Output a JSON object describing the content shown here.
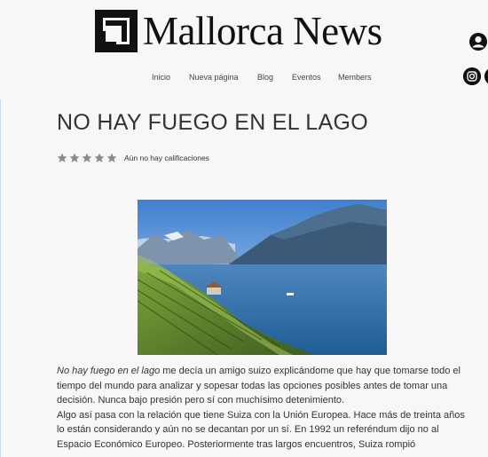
{
  "site": {
    "name": "Mallorca News"
  },
  "nav": {
    "items": [
      {
        "label": "Inicio"
      },
      {
        "label": "Nueva página"
      },
      {
        "label": "Blog"
      },
      {
        "label": "Eventos"
      },
      {
        "label": "Members"
      }
    ]
  },
  "post": {
    "title": "NO HAY FUEGO EN EL LAGO",
    "rating_text": "Aún no hay calificaciones",
    "rating_value": 0,
    "rating_max": 5,
    "paragraphs": [
      {
        "emphasis": "No hay fuego en el lago",
        "text": " me decía un amigo suizo explicándome que hay que tomarse todo el tiempo del mundo para analizar y sopesar todas las opciones posibles antes de tomar una decisión. Nunca bajo presión pero sí con muchísimo detenimiento."
      },
      {
        "emphasis": "",
        "text": "Algo así pasa con la relación que tiene Suiza con la Unión Europea. Hace más de treinta años lo están considerando y aún no se decantan por un sí. En 1992 un referéndum dijo no al Espacio Económico Europeo. Posteriormente tras largos encuentros, Suiza rompió"
      }
    ]
  },
  "icons": {
    "logo": "logo-square-icon",
    "account": "user-account-icon",
    "social": "instagram-icon",
    "star": "star-icon"
  },
  "colors": {
    "background": "#f7f7f7",
    "text": "#222222",
    "star": "#8a8a8a",
    "social": "#111111"
  }
}
